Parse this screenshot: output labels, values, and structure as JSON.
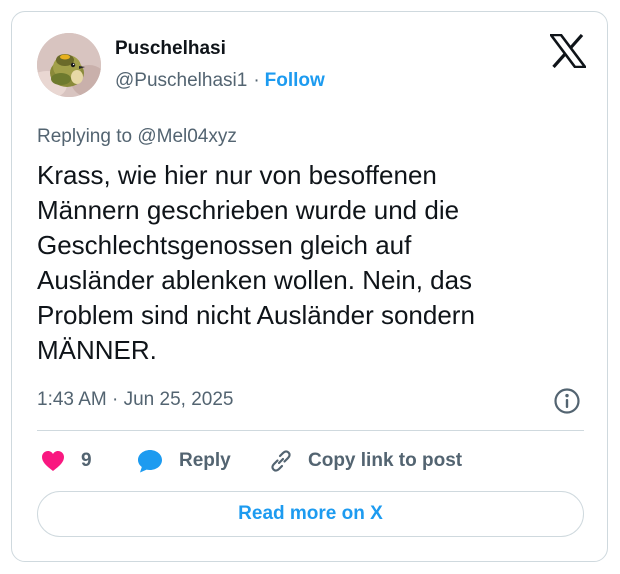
{
  "author": {
    "display_name": "Puschelhasi",
    "handle": "@Puschelhasi1",
    "separator": "·",
    "follow_label": "Follow",
    "avatar_icon": "bird-photo-avatar"
  },
  "brand": {
    "logo_icon": "x-logo-icon"
  },
  "tweet": {
    "replying_to": "Replying to @Mel04xyz",
    "text": "Krass, wie hier nur von besoffenen\nMännern geschrieben wurde und die\nGeschlechtsgenossen gleich auf\nAusländer ablenken wollen. Nein, das\nProblem sind nicht Ausländer sondern\nMÄNNER.",
    "timestamp": "1:43 AM · Jun 25, 2025"
  },
  "actions": {
    "like_count": "9",
    "reply_label": "Reply",
    "copy_link_label": "Copy link to post",
    "read_more_label": "Read more on X"
  },
  "colors": {
    "accent": "#1d9bf0",
    "like": "#f91880",
    "text_primary": "#0f1419",
    "text_secondary": "#536471",
    "border": "#cfd9de"
  }
}
